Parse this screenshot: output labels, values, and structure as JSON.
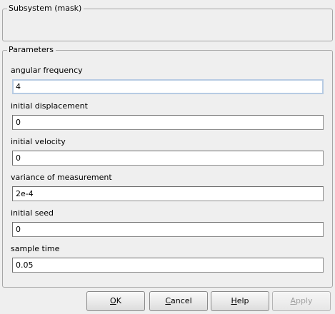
{
  "subsystem": {
    "title": "Subsystem (mask)"
  },
  "parameters": {
    "title": "Parameters",
    "fields": [
      {
        "label": "angular frequency",
        "value": "4"
      },
      {
        "label": "initial displacement",
        "value": "0"
      },
      {
        "label": "initial velocity",
        "value": "0"
      },
      {
        "label": "variance of measurement",
        "value": "2e-4"
      },
      {
        "label": "initial seed",
        "value": "0"
      },
      {
        "label": "sample time",
        "value": "0.05"
      }
    ]
  },
  "buttons": {
    "ok": "OK",
    "cancel": "Cancel",
    "help": "Help",
    "apply": "Apply"
  },
  "colors": {
    "background": "#efefef",
    "frame_border": "#a6a6a6",
    "focus_border": "#b7cbe3",
    "disabled_text": "#a0a0a0"
  }
}
